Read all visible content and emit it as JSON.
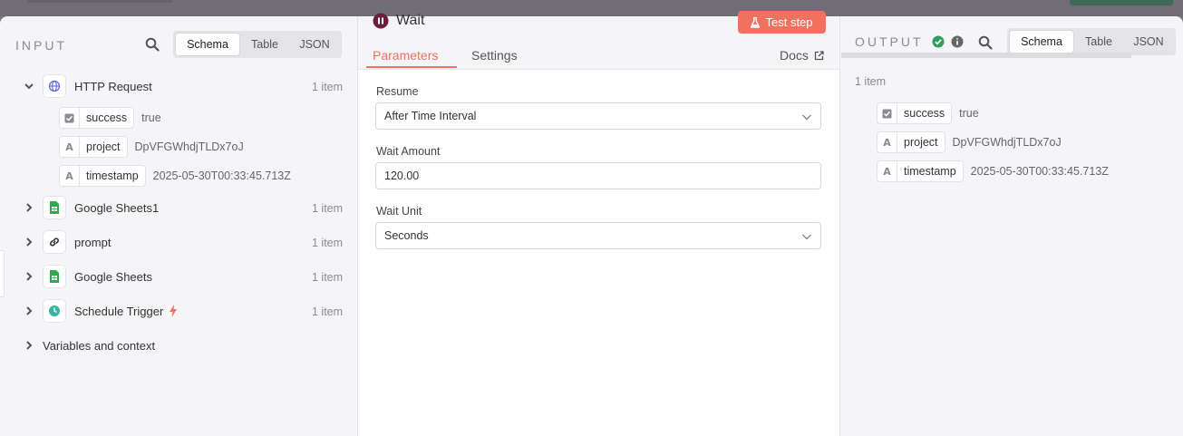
{
  "input": {
    "title": "INPUT",
    "tabs": [
      "Schema",
      "Table",
      "JSON"
    ],
    "active_tab": "Schema",
    "nodes": [
      {
        "name": "HTTP Request",
        "count": "1 item",
        "icon": "globe-icon",
        "expanded": true
      },
      {
        "name": "Google Sheets1",
        "count": "1 item",
        "icon": "google-sheets-icon"
      },
      {
        "name": "prompt",
        "count": "1 item",
        "icon": "link-icon"
      },
      {
        "name": "Google Sheets",
        "count": "1 item",
        "icon": "google-sheets-icon"
      },
      {
        "name": "Schedule Trigger",
        "count": "1 item",
        "icon": "clock-icon",
        "badge": "lightning-icon"
      }
    ],
    "fields": [
      {
        "type_icon": "checkbox-icon",
        "name": "success",
        "value": "true"
      },
      {
        "type_icon": "string-icon",
        "type_glyph": "A",
        "name": "project",
        "value": "DpVFGWhdjTLDx7oJ"
      },
      {
        "type_icon": "string-icon",
        "type_glyph": "A",
        "name": "timestamp",
        "value": "2025-05-30T00:33:45.713Z"
      }
    ],
    "variables_label": "Variables and context"
  },
  "node": {
    "title": "Wait",
    "test_label": "Test step",
    "tabs": {
      "parameters": "Parameters",
      "settings": "Settings"
    },
    "docs_label": "Docs",
    "params": {
      "resume_label": "Resume",
      "resume_value": "After Time Interval",
      "amount_label": "Wait Amount",
      "amount_value": "120.00",
      "unit_label": "Wait Unit",
      "unit_value": "Seconds"
    }
  },
  "output": {
    "title": "OUTPUT",
    "tabs": [
      "Schema",
      "Table",
      "JSON"
    ],
    "active_tab": "Schema",
    "count": "1 item",
    "fields": [
      {
        "type_icon": "checkbox-icon",
        "name": "success",
        "value": "true"
      },
      {
        "type_icon": "string-icon",
        "type_glyph": "A",
        "name": "project",
        "value": "DpVFGWhdjTLDx7oJ"
      },
      {
        "type_icon": "string-icon",
        "type_glyph": "A",
        "name": "timestamp",
        "value": "2025-05-30T00:33:45.713Z"
      }
    ]
  },
  "colors": {
    "accent": "#f0715f",
    "success": "#2f9e5f",
    "sheets_green": "#2fa84f",
    "wait_icon": "#6b1f3f",
    "globe_blue": "#5b6cd8",
    "clock_teal": "#3bb3a0"
  }
}
